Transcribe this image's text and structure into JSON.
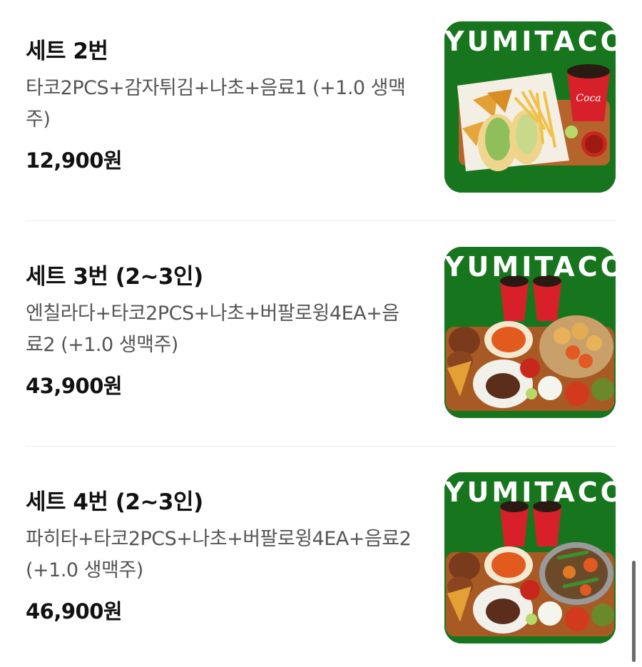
{
  "menu": {
    "items": [
      {
        "title": "세트 2번",
        "description": "타코2PCS+감자튀김+나초+음료1 (+1.0 생맥주)",
        "price": "12,900원",
        "image": {
          "brand_text": "YUMITACO",
          "alt": "taco set with fries, nachos and cola"
        }
      },
      {
        "title": "세트 3번 (2~3인)",
        "description": "엔칠라다+타코2PCS+나초+버팔로윙4EA+음료2 (+1.0 생맥주)",
        "price": "43,900원",
        "image": {
          "brand_text": "YUMITACO",
          "alt": "enchilada platter with tacos, nachos, wings and two colas"
        }
      },
      {
        "title": "세트 4번 (2~3인)",
        "description": "파히타+타코2PCS+나초+버팔로윙4EA+음료2 (+1.0 생맥주)",
        "price": "46,900원",
        "image": {
          "brand_text": "YUMITACO",
          "alt": "fajita platter with tacos, nachos, wings and two colas"
        }
      }
    ]
  },
  "colors": {
    "image_background": "#17761d",
    "title_text": "#111111",
    "description_text": "#555555",
    "divider": "#ececec"
  }
}
